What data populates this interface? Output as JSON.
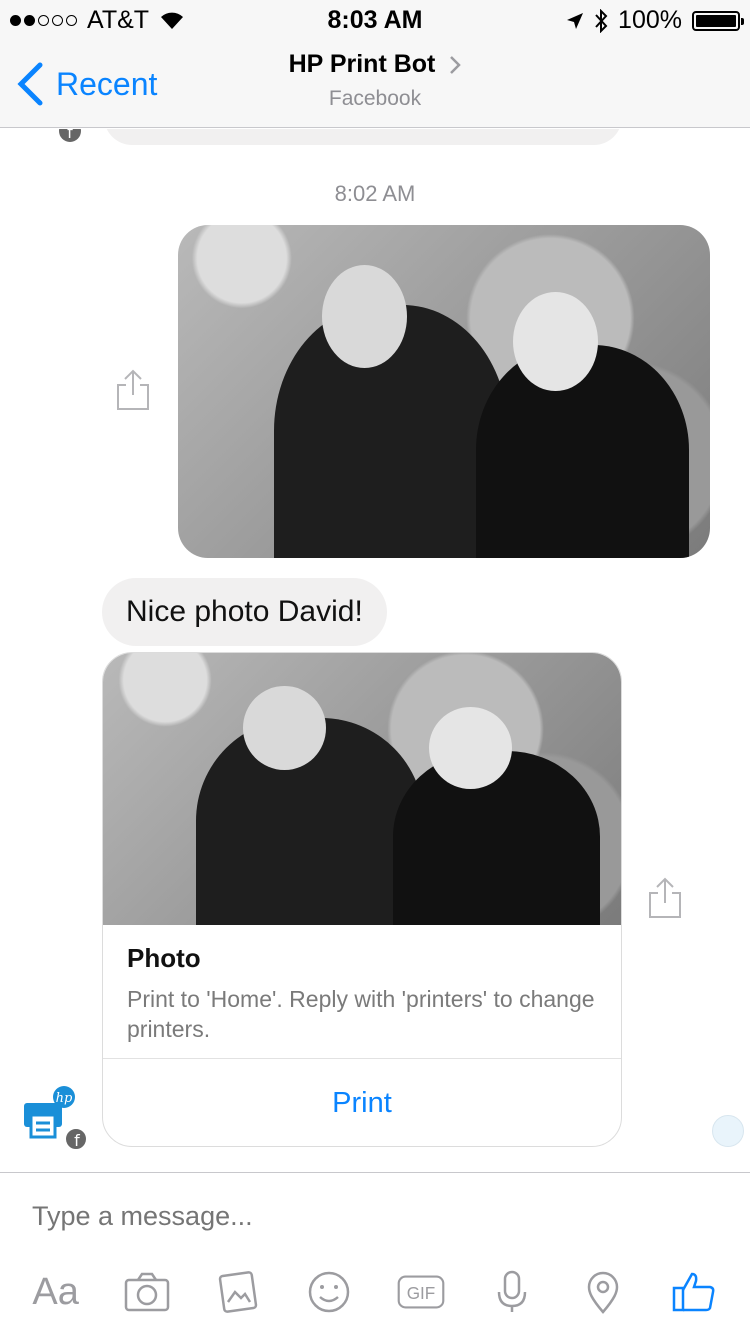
{
  "status_bar": {
    "carrier": "AT&T",
    "time": "8:03 AM",
    "battery": "100%"
  },
  "nav": {
    "back_label": "Recent",
    "title": "HP Print Bot",
    "subtitle": "Facebook"
  },
  "chat": {
    "timestamp": "8:02 AM",
    "bot_message": "Nice photo David!",
    "card": {
      "title": "Photo",
      "subtitle": "Print to 'Home'. Reply with 'printers' to change printers.",
      "button": "Print"
    }
  },
  "composer": {
    "placeholder": "Type a message...",
    "text_label": "Aa",
    "gif_label": "GIF"
  },
  "colors": {
    "accent": "#0a84ff",
    "bubble_gray": "#f1f0f0",
    "hp_blue": "#1a8fd8"
  }
}
